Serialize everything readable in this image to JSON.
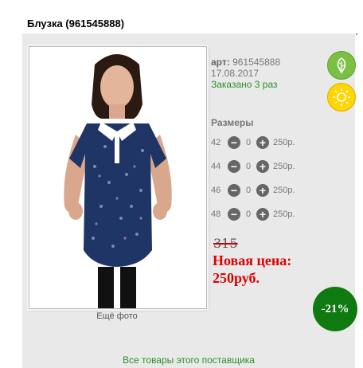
{
  "product": {
    "title": "Блузка (961545888)",
    "art_label": "арт:",
    "art_value": "961545888",
    "date": "17.08.2017",
    "ordered": "Заказано 3 раз",
    "more_photos": "Ещё фото"
  },
  "badges": {
    "eco_icon": "leaf-icon",
    "season_icon": "sun-icon"
  },
  "sizes": {
    "title": "Размеры",
    "items": [
      {
        "size": "42",
        "qty": "0",
        "price": "250р."
      },
      {
        "size": "44",
        "qty": "0",
        "price": "250р."
      },
      {
        "size": "46",
        "qty": "0",
        "price": "250р."
      },
      {
        "size": "48",
        "qty": "0",
        "price": "250р."
      }
    ],
    "minus_icon": "minus-icon",
    "plus_icon": "plus-icon"
  },
  "pricing": {
    "old_price": "315",
    "new_label": "Новая цена:",
    "new_price": "250руб.",
    "discount": "-21%"
  },
  "footer": {
    "supplier_link": "Все товары этого поставщика"
  },
  "colors": {
    "accent_green": "#2a8f2a",
    "price_red": "#d00000",
    "badge_green": "#0e7a10",
    "blouse_navy": "#1f3566"
  }
}
